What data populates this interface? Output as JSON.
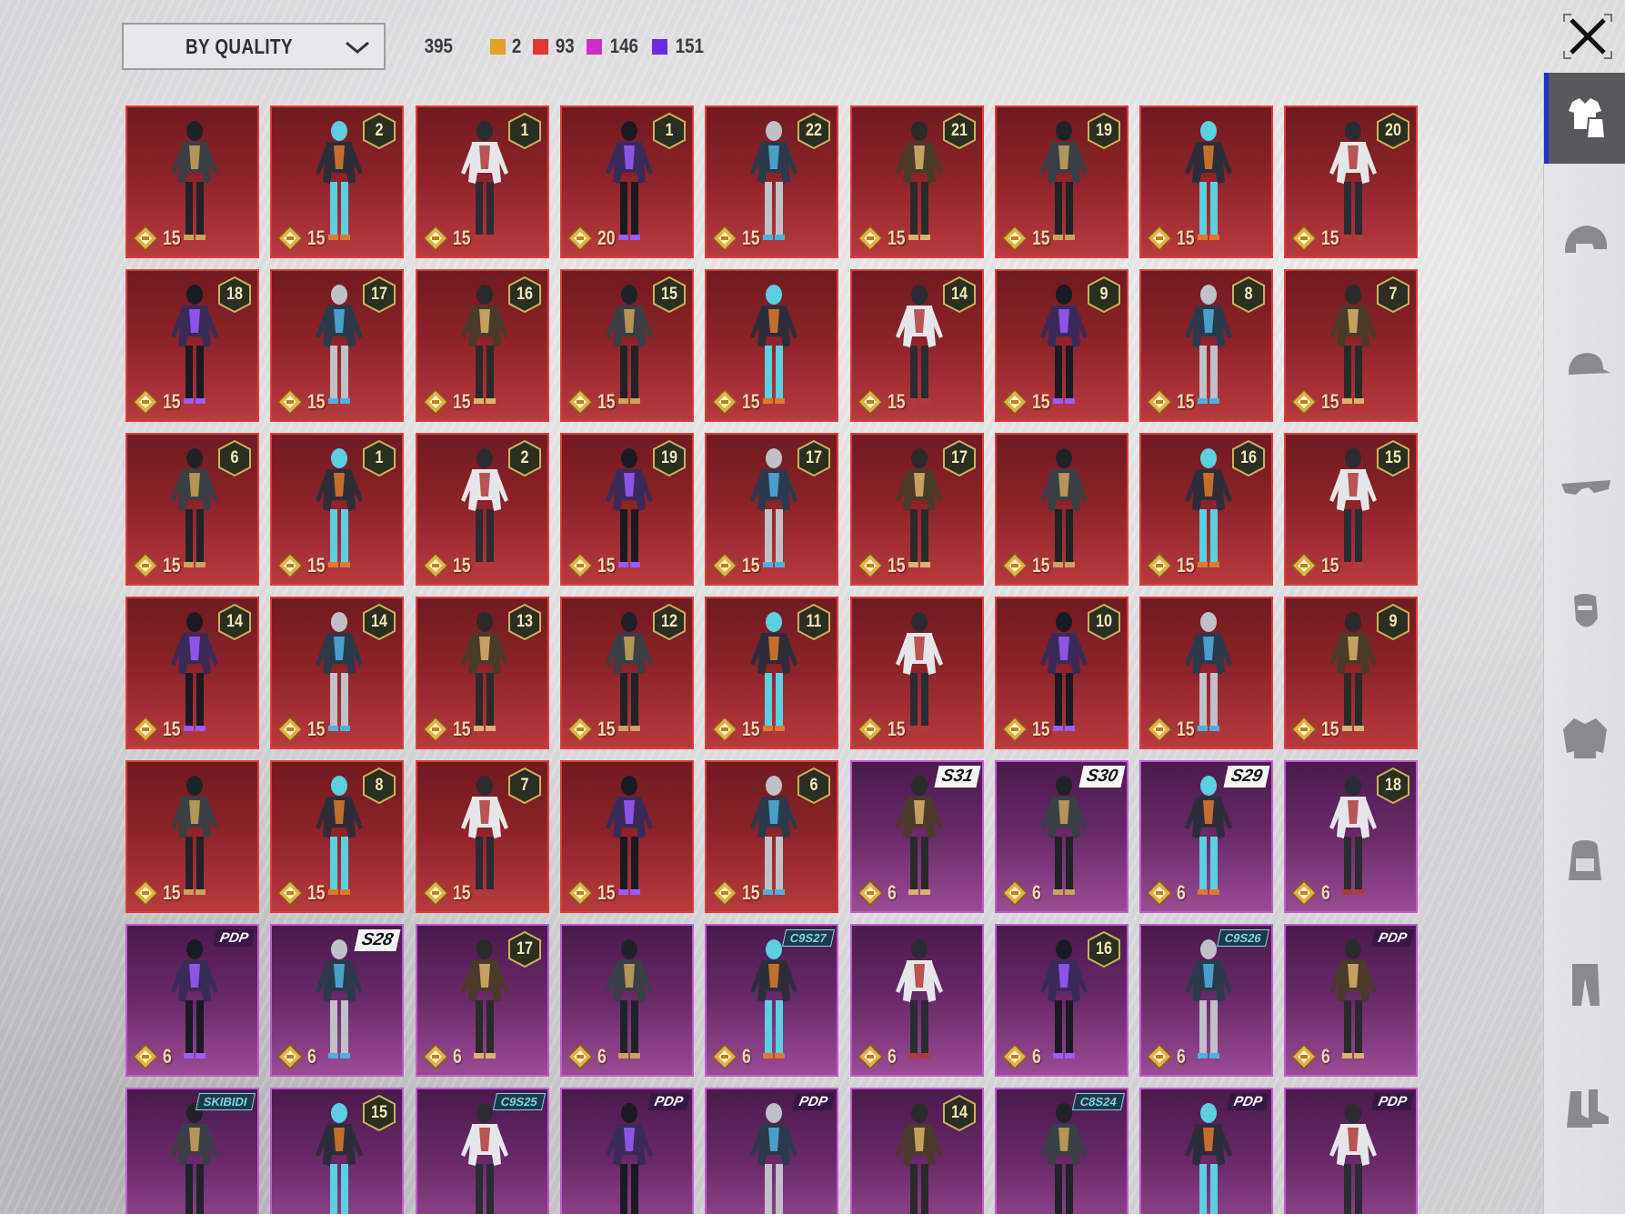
{
  "header": {
    "sort_label": "BY QUALITY",
    "total_count": "395",
    "quality_counts": [
      {
        "color": "#e0a325",
        "count": "2"
      },
      {
        "color": "#e23535",
        "count": "93"
      },
      {
        "color": "#cc2fc4",
        "count": "146"
      },
      {
        "color": "#6a2be0",
        "count": "151"
      }
    ]
  },
  "rail": {
    "items": [
      {
        "name": "outfit-icon",
        "active": true
      },
      {
        "name": "helmet-icon",
        "active": false
      },
      {
        "name": "cap-icon",
        "active": false
      },
      {
        "name": "glasses-icon",
        "active": false
      },
      {
        "name": "mask-icon",
        "active": false
      },
      {
        "name": "jacket-icon",
        "active": false
      },
      {
        "name": "backpack-icon",
        "active": false
      },
      {
        "name": "pants-icon",
        "active": false
      },
      {
        "name": "shoes-icon",
        "active": false
      }
    ]
  },
  "items": [
    {
      "quality": "red",
      "price": "15",
      "badge": "",
      "tag": ""
    },
    {
      "quality": "red",
      "price": "15",
      "badge": "2",
      "tag": ""
    },
    {
      "quality": "red",
      "price": "15",
      "badge": "1",
      "tag": ""
    },
    {
      "quality": "red",
      "price": "20",
      "badge": "1",
      "tag": ""
    },
    {
      "quality": "red",
      "price": "15",
      "badge": "22",
      "tag": ""
    },
    {
      "quality": "red",
      "price": "15",
      "badge": "21",
      "tag": ""
    },
    {
      "quality": "red",
      "price": "15",
      "badge": "19",
      "tag": ""
    },
    {
      "quality": "red",
      "price": "15",
      "badge": "",
      "tag": ""
    },
    {
      "quality": "red",
      "price": "15",
      "badge": "20",
      "tag": ""
    },
    {
      "quality": "red",
      "price": "15",
      "badge": "18",
      "tag": ""
    },
    {
      "quality": "red",
      "price": "15",
      "badge": "17",
      "tag": ""
    },
    {
      "quality": "red",
      "price": "15",
      "badge": "16",
      "tag": ""
    },
    {
      "quality": "red",
      "price": "15",
      "badge": "15",
      "tag": ""
    },
    {
      "quality": "red",
      "price": "15",
      "badge": "",
      "tag": ""
    },
    {
      "quality": "red",
      "price": "15",
      "badge": "14",
      "tag": ""
    },
    {
      "quality": "red",
      "price": "15",
      "badge": "9",
      "tag": ""
    },
    {
      "quality": "red",
      "price": "15",
      "badge": "8",
      "tag": ""
    },
    {
      "quality": "red",
      "price": "15",
      "badge": "7",
      "tag": ""
    },
    {
      "quality": "red",
      "price": "15",
      "badge": "6",
      "tag": ""
    },
    {
      "quality": "red",
      "price": "15",
      "badge": "1",
      "tag": ""
    },
    {
      "quality": "red",
      "price": "15",
      "badge": "2",
      "tag": ""
    },
    {
      "quality": "red",
      "price": "15",
      "badge": "19",
      "tag": ""
    },
    {
      "quality": "red",
      "price": "15",
      "badge": "17",
      "tag": ""
    },
    {
      "quality": "red",
      "price": "15",
      "badge": "17",
      "tag": ""
    },
    {
      "quality": "red",
      "price": "15",
      "badge": "",
      "tag": ""
    },
    {
      "quality": "red",
      "price": "15",
      "badge": "16",
      "tag": ""
    },
    {
      "quality": "red",
      "price": "15",
      "badge": "15",
      "tag": ""
    },
    {
      "quality": "red",
      "price": "15",
      "badge": "14",
      "tag": ""
    },
    {
      "quality": "red",
      "price": "15",
      "badge": "14",
      "tag": ""
    },
    {
      "quality": "red",
      "price": "15",
      "badge": "13",
      "tag": ""
    },
    {
      "quality": "red",
      "price": "15",
      "badge": "12",
      "tag": ""
    },
    {
      "quality": "red",
      "price": "15",
      "badge": "11",
      "tag": ""
    },
    {
      "quality": "red",
      "price": "15",
      "badge": "",
      "tag": ""
    },
    {
      "quality": "red",
      "price": "15",
      "badge": "10",
      "tag": ""
    },
    {
      "quality": "red",
      "price": "15",
      "badge": "",
      "tag": ""
    },
    {
      "quality": "red",
      "price": "15",
      "badge": "9",
      "tag": ""
    },
    {
      "quality": "red",
      "price": "15",
      "badge": "",
      "tag": ""
    },
    {
      "quality": "red",
      "price": "15",
      "badge": "8",
      "tag": ""
    },
    {
      "quality": "red",
      "price": "15",
      "badge": "7",
      "tag": ""
    },
    {
      "quality": "red",
      "price": "15",
      "badge": "",
      "tag": ""
    },
    {
      "quality": "red",
      "price": "15",
      "badge": "6",
      "tag": ""
    },
    {
      "quality": "purple",
      "price": "6",
      "badge": "",
      "tag": "S31"
    },
    {
      "quality": "purple",
      "price": "6",
      "badge": "",
      "tag": "S30"
    },
    {
      "quality": "purple",
      "price": "6",
      "badge": "",
      "tag": "S29"
    },
    {
      "quality": "purple",
      "price": "6",
      "badge": "18",
      "tag": ""
    },
    {
      "quality": "purple",
      "price": "6",
      "badge": "",
      "tag": "PDP"
    },
    {
      "quality": "purple",
      "price": "6",
      "badge": "",
      "tag": "S28"
    },
    {
      "quality": "purple",
      "price": "6",
      "badge": "17",
      "tag": ""
    },
    {
      "quality": "purple",
      "price": "6",
      "badge": "",
      "tag": ""
    },
    {
      "quality": "purple",
      "price": "6",
      "badge": "",
      "tag": "C9S27"
    },
    {
      "quality": "purple",
      "price": "6",
      "badge": "",
      "tag": ""
    },
    {
      "quality": "purple",
      "price": "6",
      "badge": "16",
      "tag": ""
    },
    {
      "quality": "purple",
      "price": "6",
      "badge": "",
      "tag": "C9S26"
    },
    {
      "quality": "purple",
      "price": "6",
      "badge": "",
      "tag": "PDP"
    },
    {
      "quality": "purple",
      "price": "",
      "badge": "",
      "tag": "SKIBIDI"
    },
    {
      "quality": "purple",
      "price": "",
      "badge": "15",
      "tag": ""
    },
    {
      "quality": "purple",
      "price": "",
      "badge": "",
      "tag": "C9S25"
    },
    {
      "quality": "purple",
      "price": "",
      "badge": "",
      "tag": "PDP"
    },
    {
      "quality": "purple",
      "price": "",
      "badge": "",
      "tag": "PDP"
    },
    {
      "quality": "purple",
      "price": "",
      "badge": "14",
      "tag": ""
    },
    {
      "quality": "purple",
      "price": "",
      "badge": "",
      "tag": "C8S24"
    },
    {
      "quality": "purple",
      "price": "",
      "badge": "",
      "tag": "PDP"
    },
    {
      "quality": "purple",
      "price": "",
      "badge": "",
      "tag": "PDP"
    }
  ]
}
